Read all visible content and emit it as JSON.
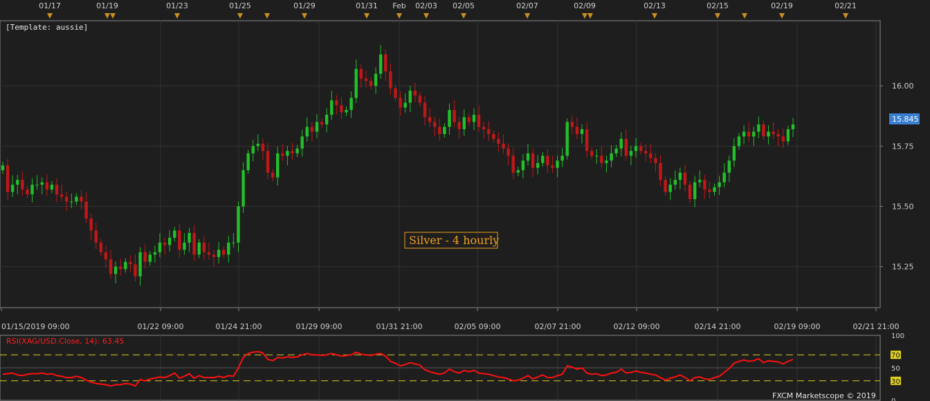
{
  "template_label": "[Template: aussie]",
  "annotation": "Silver - 4 hourly",
  "last_price": "15.845",
  "footer_brand": "FXCM Marketscope © 2019",
  "top_date_labels": [
    "01/17",
    "01/19",
    "01/23",
    "01/25",
    "01/29",
    "01/31",
    "Feb",
    "02/03",
    "02/05",
    "02/07",
    "02/09",
    "02/13",
    "02/15",
    "02/19",
    "02/21"
  ],
  "bottom_date_labels": [
    "01/15/2019 09:00",
    "01/22 09:00",
    "01/24 21:00",
    "01/29 09:00",
    "01/31 21:00",
    "02/05 09:00",
    "02/07 21:00",
    "02/12 09:00",
    "02/14 21:00",
    "02/19 09:00",
    "02/21 21:00"
  ],
  "price_ticks": [
    "16.00",
    "15.75",
    "15.50",
    "15.25"
  ],
  "rsi": {
    "label": "RSI(XAG/USD.Close, 14): 63.45",
    "ticks": [
      "100",
      "70",
      "50",
      "30",
      "0"
    ]
  },
  "colors": {
    "bg": "#1e1e1e",
    "up": "#22c02a",
    "down": "#c01818",
    "grid": "#333333",
    "rsi_line": "#ff1010",
    "rsi_levels": "#e0d020",
    "event_marker": "#c89020",
    "price_tag": "#3a7fd0"
  },
  "chart_data": [
    {
      "type": "candlestick",
      "title": "",
      "instrument": "Silver - 4 hourly",
      "ylim": [
        15.08,
        16.27
      ],
      "y_ticks": [
        16.0,
        15.75,
        15.5,
        15.25
      ],
      "last_price": 15.845,
      "grid": true,
      "closes": [
        15.67,
        15.56,
        15.59,
        15.61,
        15.57,
        15.55,
        15.59,
        15.59,
        15.6,
        15.57,
        15.59,
        15.55,
        15.54,
        15.52,
        15.52,
        15.54,
        15.52,
        15.45,
        15.4,
        15.35,
        15.31,
        15.28,
        15.22,
        15.25,
        15.24,
        15.27,
        15.26,
        15.21,
        15.31,
        15.27,
        15.3,
        15.31,
        15.35,
        15.34,
        15.37,
        15.4,
        15.32,
        15.35,
        15.39,
        15.3,
        15.35,
        15.31,
        15.3,
        15.29,
        15.32,
        15.3,
        15.35,
        15.35,
        15.5,
        15.65,
        15.72,
        15.75,
        15.76,
        15.73,
        15.64,
        15.62,
        15.72,
        15.71,
        15.73,
        15.72,
        15.74,
        15.79,
        15.83,
        15.81,
        15.85,
        15.84,
        15.88,
        15.94,
        15.92,
        15.89,
        15.9,
        15.95,
        16.07,
        16.03,
        16.02,
        16.0,
        16.05,
        16.13,
        16.06,
        15.99,
        15.95,
        15.91,
        15.93,
        15.98,
        15.96,
        15.93,
        15.87,
        15.85,
        15.83,
        15.8,
        15.83,
        15.9,
        15.85,
        15.82,
        15.87,
        15.85,
        15.88,
        15.83,
        15.82,
        15.8,
        15.78,
        15.76,
        15.74,
        15.71,
        15.64,
        15.65,
        15.69,
        15.72,
        15.66,
        15.68,
        15.71,
        15.67,
        15.66,
        15.69,
        15.71,
        15.85,
        15.83,
        15.8,
        15.82,
        15.73,
        15.71,
        15.71,
        15.68,
        15.69,
        15.72,
        15.74,
        15.78,
        15.71,
        15.73,
        15.75,
        15.73,
        15.72,
        15.7,
        15.68,
        15.61,
        15.56,
        15.59,
        15.61,
        15.64,
        15.59,
        15.53,
        15.6,
        15.61,
        15.57,
        15.56,
        15.58,
        15.6,
        15.64,
        15.69,
        15.75,
        15.79,
        15.81,
        15.79,
        15.81,
        15.84,
        15.79,
        15.81,
        15.8,
        15.79,
        15.77,
        15.82,
        15.84
      ]
    },
    {
      "type": "line",
      "title": "RSI(XAG/USD.Close, 14): 63.45",
      "ylim": [
        0,
        100
      ],
      "y_ticks": [
        100,
        70,
        50,
        30,
        0
      ],
      "levels": [
        70,
        50,
        30
      ],
      "current": 63.45,
      "values": [
        40,
        41,
        42,
        39,
        38,
        40,
        41,
        41,
        42,
        40,
        41,
        38,
        37,
        35,
        35,
        37,
        35,
        31,
        28,
        26,
        25,
        24,
        22,
        24,
        24,
        26,
        25,
        22,
        32,
        30,
        33,
        34,
        36,
        35,
        38,
        42,
        34,
        37,
        41,
        34,
        38,
        35,
        35,
        35,
        37,
        35,
        38,
        37,
        50,
        66,
        72,
        74,
        75,
        73,
        63,
        61,
        66,
        65,
        67,
        66,
        67,
        70,
        72,
        70,
        70,
        69,
        70,
        72,
        70,
        68,
        69,
        70,
        74,
        71,
        70,
        69,
        71,
        72,
        68,
        60,
        57,
        53,
        55,
        58,
        56,
        54,
        47,
        44,
        42,
        40,
        42,
        48,
        44,
        42,
        46,
        44,
        46,
        42,
        41,
        40,
        38,
        36,
        35,
        33,
        30,
        31,
        34,
        38,
        33,
        36,
        39,
        35,
        35,
        38,
        40,
        53,
        51,
        48,
        50,
        42,
        40,
        41,
        38,
        39,
        42,
        43,
        48,
        42,
        43,
        45,
        43,
        42,
        40,
        39,
        35,
        31,
        34,
        36,
        39,
        35,
        30,
        35,
        36,
        33,
        32,
        35,
        37,
        43,
        49,
        57,
        60,
        62,
        60,
        61,
        64,
        58,
        61,
        60,
        59,
        56,
        60,
        63
      ]
    }
  ]
}
